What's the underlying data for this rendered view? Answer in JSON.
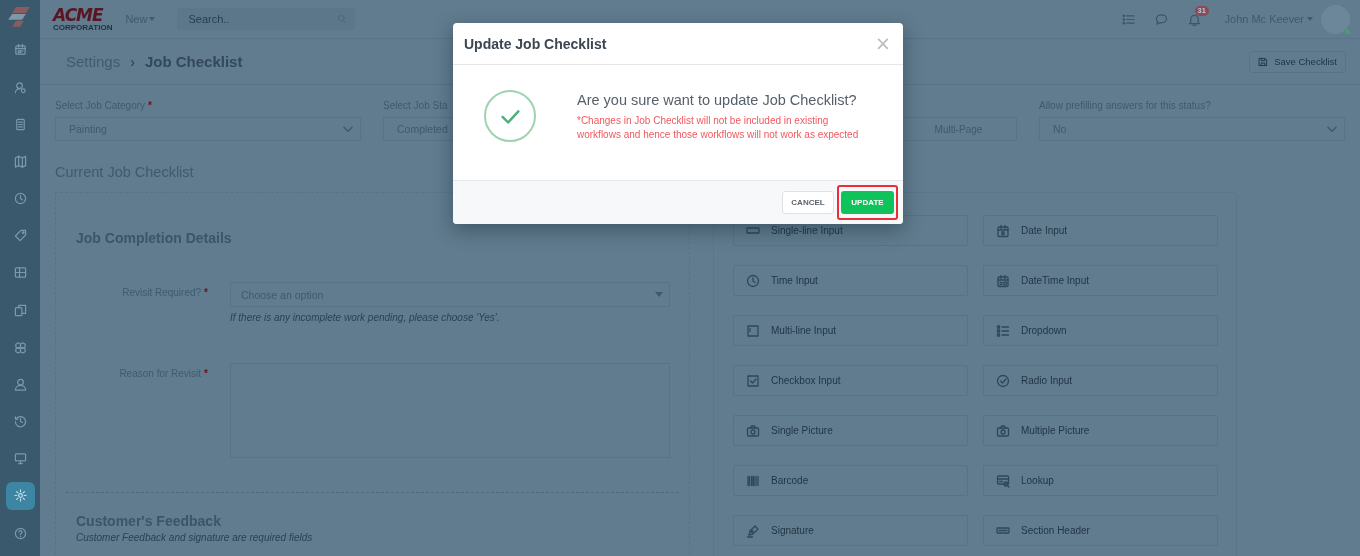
{
  "sidebar": {
    "items": [
      {
        "kind": "calendar",
        "selected": false
      },
      {
        "kind": "contacts",
        "selected": false
      },
      {
        "kind": "invoice",
        "selected": false
      },
      {
        "kind": "map",
        "selected": false
      },
      {
        "kind": "clock",
        "selected": false
      },
      {
        "kind": "tag",
        "selected": false
      },
      {
        "kind": "table",
        "selected": false
      },
      {
        "kind": "files",
        "selected": false
      },
      {
        "kind": "boxes",
        "selected": false
      },
      {
        "kind": "person",
        "selected": false
      },
      {
        "kind": "history",
        "selected": false
      },
      {
        "kind": "monitor",
        "selected": false
      },
      {
        "kind": "settings",
        "selected": true
      },
      {
        "kind": "help",
        "selected": false
      }
    ]
  },
  "topbar": {
    "logo_text": "ACME",
    "logo_subtext": "CORPORATION",
    "new_menu": "New",
    "search": {
      "placeholder": "Search.."
    },
    "notifications_count": "31",
    "user_name": "John Mc Keever",
    "user_online": true
  },
  "breadcrumb": {
    "parent": "Settings",
    "separator": "›",
    "current": "Job Checklist"
  },
  "save_button": "Save Checklist",
  "filters": [
    {
      "kind": "select",
      "label": "Select Job Category",
      "required": "*",
      "value": "Painting"
    },
    {
      "kind": "select",
      "label": "Select Job Sta",
      "value": "Completed"
    },
    {
      "kind": "toggle",
      "value": "Multi-Page"
    },
    {
      "kind": "select",
      "label": "Allow prefilling answers for this status?",
      "value": "No"
    }
  ],
  "section_title": "Current Job Checklist",
  "checklist": {
    "sections": [
      {
        "title": "Job Completion Details",
        "fields": [
          {
            "kind": "select",
            "label": "Revisit Required?",
            "required": "*",
            "placeholder": "Choose an option",
            "hint": "If there is any incomplete work pending, please choose 'Yes'."
          },
          {
            "kind": "textarea",
            "label": "Reason for Revisit",
            "required": "*"
          }
        ]
      },
      {
        "title": "Customer's Feedback",
        "subtitle": "Customer Feedback and signature are required fields"
      }
    ]
  },
  "palette": [
    {
      "kind": "single-line",
      "label": "Single-line Input"
    },
    {
      "kind": "date",
      "label": "Date Input"
    },
    {
      "kind": "time",
      "label": "Time Input"
    },
    {
      "kind": "datetime",
      "label": "DateTime Input"
    },
    {
      "kind": "multi-line",
      "label": "Multi-line Input"
    },
    {
      "kind": "dropdown",
      "label": "Dropdown"
    },
    {
      "kind": "checkbox",
      "label": "Checkbox Input"
    },
    {
      "kind": "radio",
      "label": "Radio Input"
    },
    {
      "kind": "camera",
      "label": "Single Picture"
    },
    {
      "kind": "camera",
      "label": "Multiple Picture"
    },
    {
      "kind": "barcode",
      "label": "Barcode"
    },
    {
      "kind": "lookup",
      "label": "Lookup"
    },
    {
      "kind": "signature",
      "label": "Signature"
    },
    {
      "kind": "section",
      "label": "Section Header"
    }
  ],
  "dialog": {
    "title": "Update Job Checklist",
    "close": "×",
    "question": "Are you sure want to update Job Checklist?",
    "warning": "*Changes in Job Checklist will not be included in existing workflows and hence those workflows will not work as expected",
    "buttons": [
      {
        "kind": "secondary",
        "label": "CANCEL",
        "highlighted": false
      },
      {
        "kind": "primary",
        "label": "UPDATE",
        "highlighted": true
      }
    ]
  }
}
